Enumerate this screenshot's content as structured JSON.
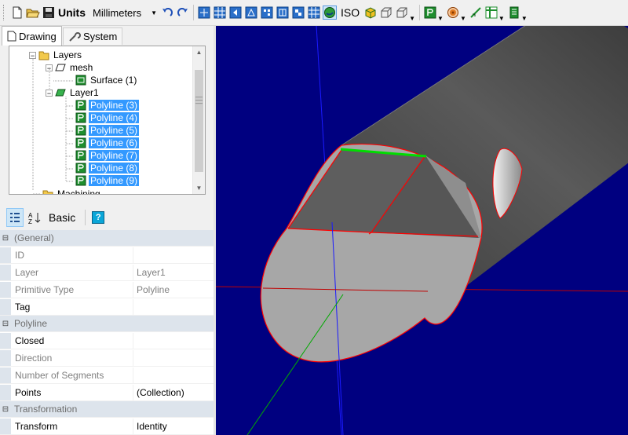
{
  "toolbar": {
    "units_label": "Units",
    "units_value": "Millimeters",
    "iso_label": "ISO",
    "icons": [
      "new-icon",
      "open-icon",
      "save-icon",
      "undo-icon",
      "redo-icon",
      "view-fit-icon",
      "view-grid-icon",
      "view-front-icon",
      "view-back-icon",
      "view-left-icon",
      "view-right-icon",
      "view-top-icon",
      "view-bottom-icon",
      "shaded-view-icon",
      "iso-view-icon",
      "cube-solid-icon",
      "cube-wire-icon",
      "polyline-tool-icon",
      "target-icon",
      "measure-icon",
      "table-icon",
      "layers-panel-icon"
    ]
  },
  "tabs": {
    "drawing": "Drawing",
    "system": "System"
  },
  "tree": {
    "layers": "Layers",
    "mesh": "mesh",
    "surface": "Surface (1)",
    "layer1": "Layer1",
    "polylines": [
      "Polyline (3)",
      "Polyline (4)",
      "Polyline (5)",
      "Polyline (6)",
      "Polyline (7)",
      "Polyline (8)",
      "Polyline (9)"
    ],
    "machining": "Machining"
  },
  "propbar": {
    "basic": "Basic",
    "help": "?"
  },
  "properties": {
    "cat_general": "(General)",
    "id_label": "ID",
    "id_value": "",
    "layer_label": "Layer",
    "layer_value": "Layer1",
    "ptype_label": "Primitive Type",
    "ptype_value": "Polyline",
    "tag_label": "Tag",
    "tag_value": "",
    "cat_polyline": "Polyline",
    "closed_label": "Closed",
    "closed_value": "",
    "direction_label": "Direction",
    "direction_value": "",
    "nseg_label": "Number of Segments",
    "nseg_value": "",
    "points_label": "Points",
    "points_value": "(Collection)",
    "cat_transformation": "Transformation",
    "transform_label": "Transform",
    "transform_value": "Identity"
  },
  "colors": {
    "viewport_bg": "#000080",
    "selection": "#3399ff",
    "edge_red": "#ff0000",
    "edge_green": "#00dd00"
  }
}
